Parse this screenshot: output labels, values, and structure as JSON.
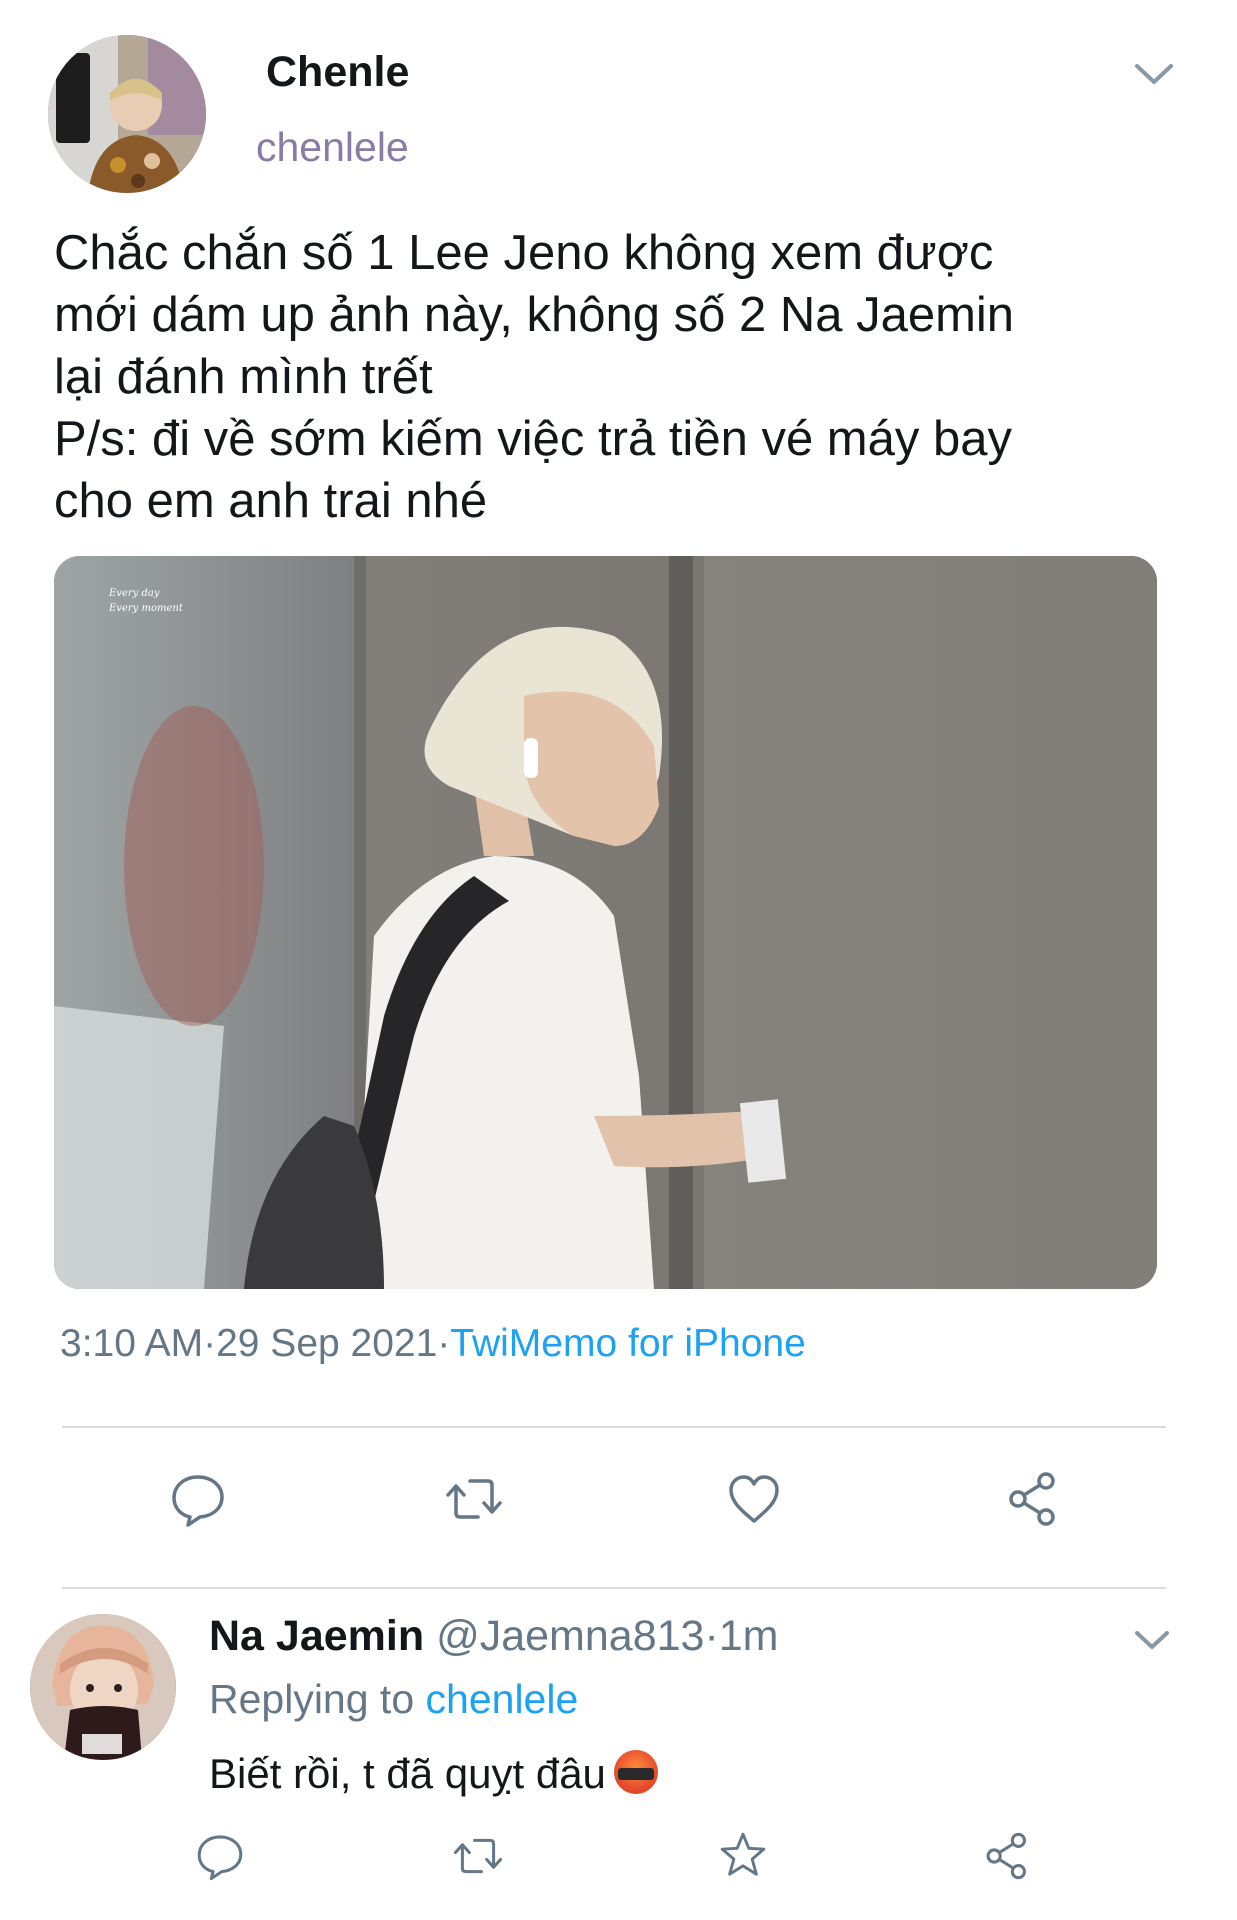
{
  "tweet": {
    "display_name": "Chenle",
    "handle": "chenlele",
    "text_lines": [
      "Chắc chắn số 1 Lee Jeno không xem được",
      "mới dám up ảnh này, không số 2 Na Jaemin",
      "lại đánh mình trết",
      "P/s: đi về sớm kiếm việc trả tiền vé máy bay",
      "cho em anh trai nhé"
    ],
    "time": "3:10 AM",
    "date": "29 Sep 2021",
    "source": "TwiMemo for iPhone"
  },
  "photo": {
    "watermark_line1": "Every day",
    "watermark_line2": "Every moment"
  },
  "actions": {
    "icons": [
      "reply-icon",
      "retweet-icon",
      "like-icon",
      "share-icon"
    ]
  },
  "reply": {
    "display_name": "Na Jaemin",
    "handle": "@Jaemna813",
    "age": "1m",
    "replying_prefix": "Replying to",
    "replying_to": "chenlele",
    "text": "Biết rồi, t đã quỵt đâu",
    "emoji": "face-with-symbols-on-mouth",
    "icons": [
      "reply-icon",
      "retweet-icon",
      "star-icon",
      "share-icon"
    ]
  },
  "colors": {
    "accent": "#1da1f2",
    "text": "#14171a",
    "muted": "#657786",
    "handle": "#8a7aa6",
    "divider": "#d6dbe0"
  }
}
